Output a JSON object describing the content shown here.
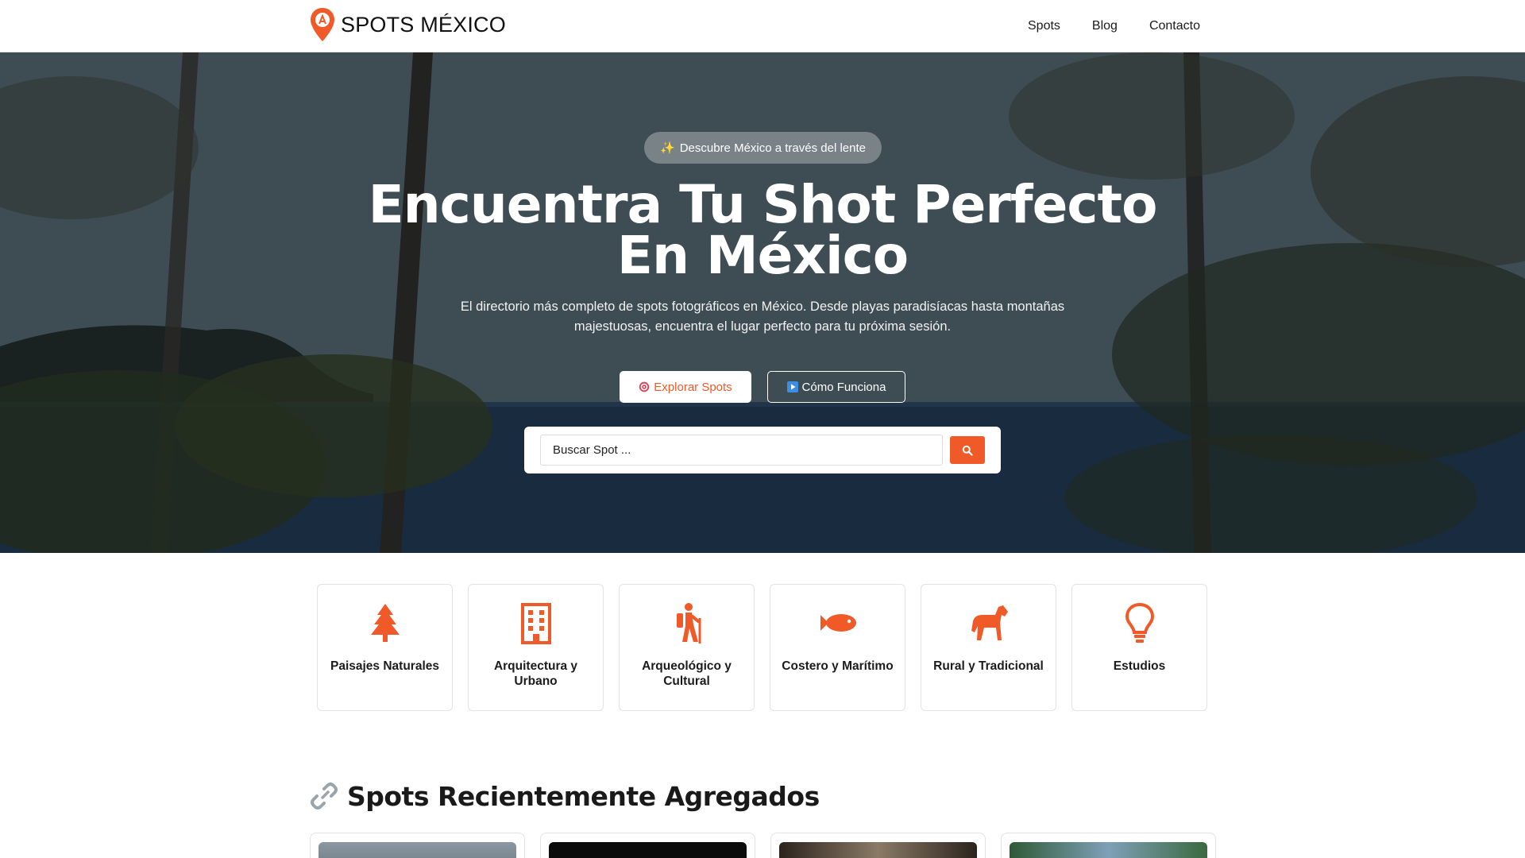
{
  "brand": {
    "name": "SPOTS MÉXICO",
    "accent": "#f05a28"
  },
  "nav": {
    "links": [
      "Spots",
      "Blog",
      "Contacto"
    ]
  },
  "hero": {
    "badge": "Descubre México a través del lente",
    "badge_icon": "sparkles-icon",
    "title_line1": "Encuentra Tu Shot Perfecto",
    "title_line2": "En México",
    "subtitle": "El directorio más completo de spots fotográficos en México. Desde playas paradisíacas hasta montañas majestuosas, encuentra el lugar perfecto para tu próxima sesión.",
    "primary_button": "Explorar Spots",
    "primary_icon": "target-icon",
    "secondary_button": "Cómo Funciona",
    "secondary_icon": "play-icon",
    "search_placeholder": "Buscar Spot ...",
    "search_icon": "search-icon"
  },
  "categories": [
    {
      "label": "Paisajes Naturales",
      "icon": "tree-icon"
    },
    {
      "label": "Arquitectura y Urbano",
      "icon": "building-icon"
    },
    {
      "label": "Arqueológico y Cultural",
      "icon": "hiker-icon"
    },
    {
      "label": "Costero y Marítimo",
      "icon": "fish-icon"
    },
    {
      "label": "Rural y Tradicional",
      "icon": "horse-icon"
    },
    {
      "label": "Estudios",
      "icon": "lightbulb-icon"
    }
  ],
  "recent": {
    "title": "Spots Recientemente Agregados",
    "icon": "link-icon"
  }
}
